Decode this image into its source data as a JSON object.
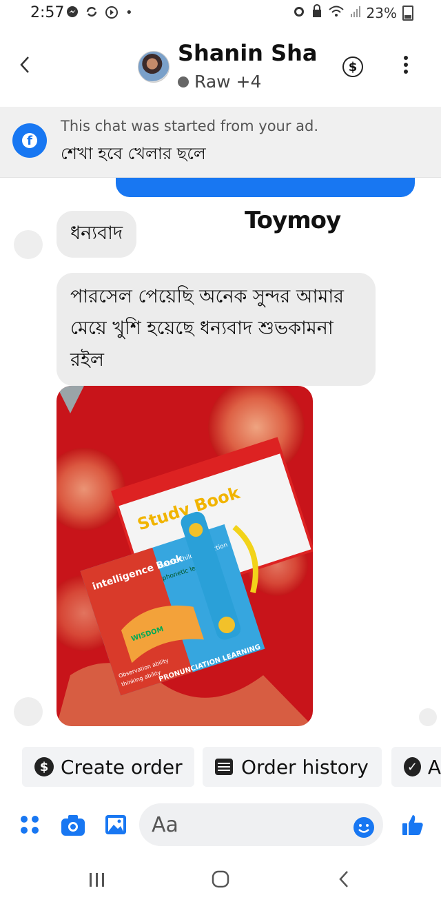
{
  "status_bar": {
    "time": "2:57",
    "battery": "23%",
    "left_icons": [
      "messenger-icon",
      "sync-icon",
      "no-sign-icon",
      "dot-icon"
    ],
    "right_icons": [
      "alarm-icon",
      "lock-icon",
      "wifi-icon",
      "signal-icon",
      "battery-icon"
    ]
  },
  "header": {
    "back_label": "‹",
    "contact_name": "Shanin Sha",
    "subtitle": "Raw +4",
    "dollar_icon": "dollar-icon",
    "more_icon": "more-vert-icon"
  },
  "ad_banner": {
    "line1": "This chat was started from your ad.",
    "line2": "শেখা হবে খেলার ছলে",
    "icon": "facebook-icon"
  },
  "chat": {
    "watermark": "Toymoy",
    "messages": [
      {
        "from": "contact",
        "type": "text",
        "text": "ধন্যবাদ"
      },
      {
        "from": "contact",
        "type": "text",
        "text": "পারসেল পেয়েছি অনেক সুন্দর আমার মেয়ে খুশি হয়েছে ধন্যবাদ শুভকামনা রইল"
      },
      {
        "from": "contact",
        "type": "image",
        "alt": "study books photo"
      }
    ]
  },
  "product_photo": {
    "title_top": "Study Book",
    "title_main": "intelligence Book",
    "tag1": "Parent-child interaction",
    "tag2": "phonetic learning",
    "word": "WISDOM",
    "side1": "Observation ability",
    "side2": "thinking ability",
    "bottom": "PRONUNCIATION LEARNING"
  },
  "quick_replies": [
    {
      "label": "Create order",
      "icon": "dollar-circle-icon"
    },
    {
      "label": "Order history",
      "icon": "receipt-icon"
    },
    {
      "label": "A",
      "icon": "check-circle-icon"
    }
  ],
  "composer": {
    "placeholder": "Aa",
    "icons": [
      "apps-icon",
      "camera-icon",
      "gallery-icon",
      "emoji-icon",
      "like-icon"
    ]
  },
  "nav_bar": {
    "recents": "|||",
    "home": "○",
    "back": "‹"
  },
  "colors": {
    "messenger_blue": "#1877f2",
    "bubble_gray": "#ececec",
    "banner_gray": "#f0f0f0"
  }
}
